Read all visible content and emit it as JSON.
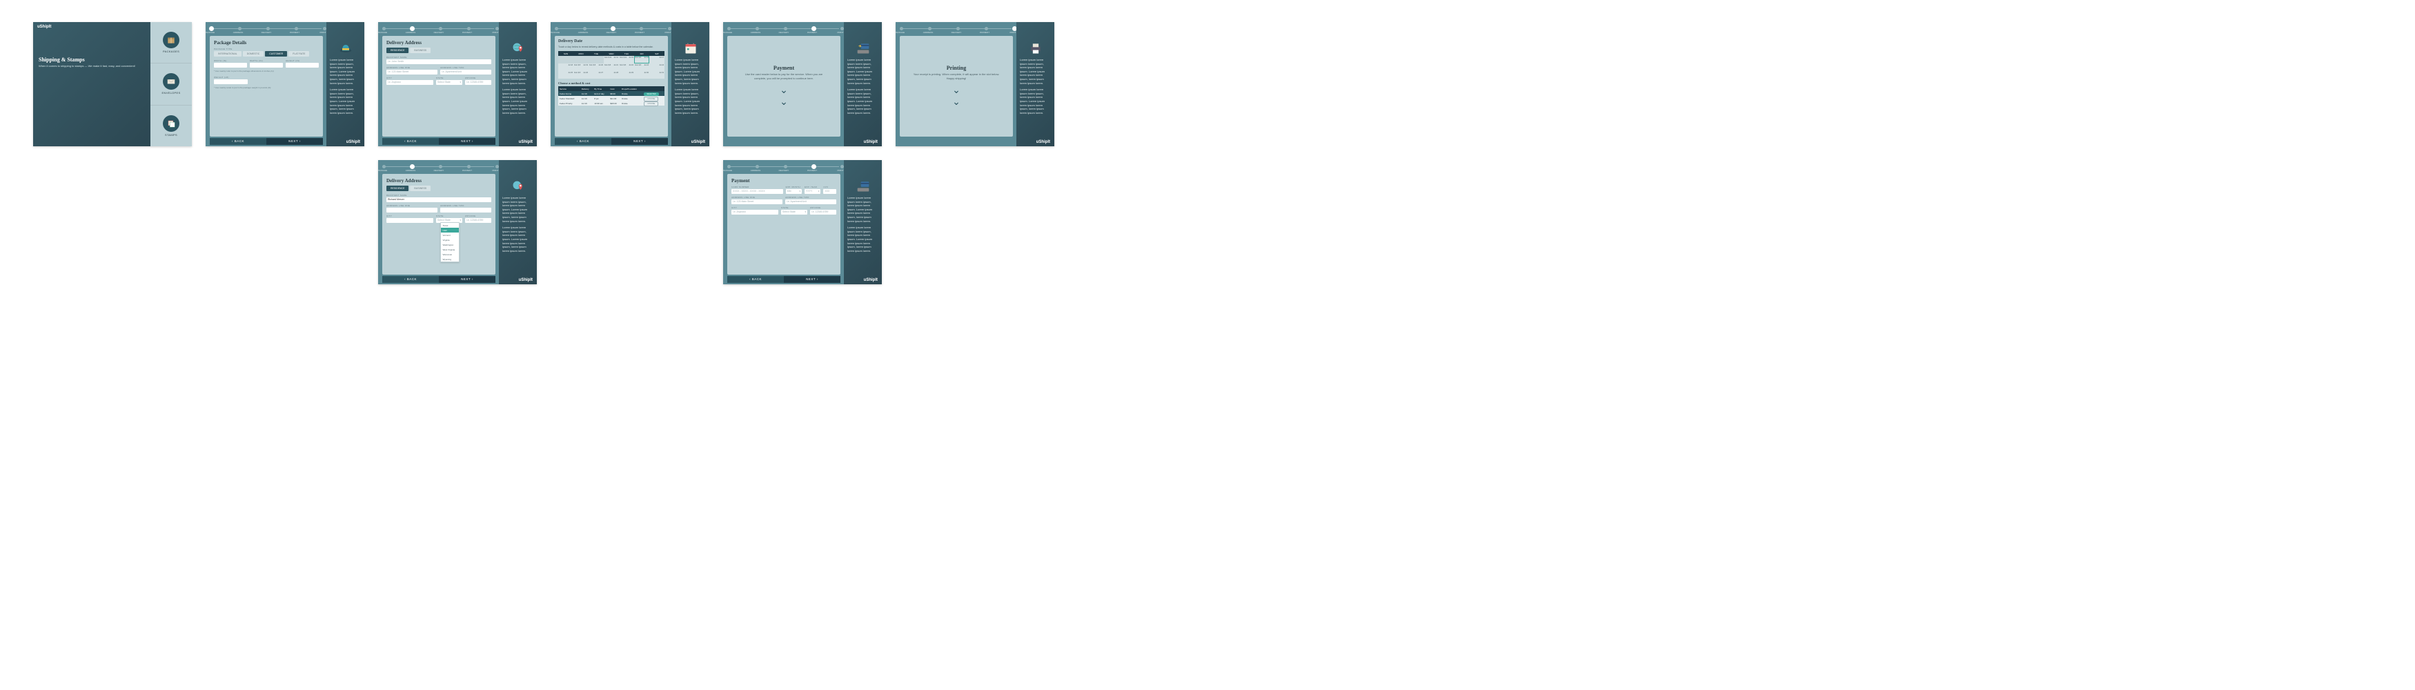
{
  "brand": "uShipIt",
  "lorem_block": "Lorem ipsum lorem ipsum lorem ipsum, lorem ipsum lorem ipsum. Lorem ipsum lorem ipsum lorem ipsum, lorem ipsum lorem ipsum lorem.",
  "stepper": {
    "steps": [
      "PACKAGE",
      "ADDRESS",
      "DELIVERY",
      "PAYMENT",
      "PRINT"
    ]
  },
  "nav": {
    "back": "‹ BACK",
    "next": "NEXT ›"
  },
  "landing": {
    "title": "Shipping & Stamps",
    "tagline": "When it comes to shipping to stamps — We make it fast, easy, and convenient!",
    "menu": [
      {
        "label": "PACKAGES",
        "icon": "box"
      },
      {
        "label": "ENVELOPES",
        "icon": "envelope"
      },
      {
        "label": "STAMPS",
        "icon": "stamps"
      }
    ]
  },
  "package": {
    "title": "Package Details",
    "section_type": "PACKAGE TYPE",
    "tabs": [
      "INTERNATIONAL",
      "DOMESTIC",
      "CUSTOMER",
      "FLAT RATE"
    ],
    "tab_active": 2,
    "dims_label": "WIDTH (IN)",
    "dims2": "DEPTH (IN)",
    "dims3": "HEIGHT (IN)",
    "dims_note": "* Use nearby ruler to put in the package dimensions in inches (in)",
    "weight_label": "WEIGHT (LB)",
    "weight_note": "* Use nearby scale to put in the package weight in pounds (lb)"
  },
  "address": {
    "title": "Delivery Address",
    "tabs": [
      "RESIDENCE",
      "BUSINESS"
    ],
    "tab_active": 0,
    "labels": {
      "name": "RECIPIENT NAME",
      "addr1": "ADDRESS LINE ONE",
      "addr2": "ADDRESS LINE TWO",
      "city": "CITY",
      "state": "STATE",
      "zip": "ZIPCODE"
    },
    "placeholders": {
      "name": "i.e. John Smith",
      "addr1": "i.e. 123 Main Street",
      "addr2": "i.e. Apartment/Unit",
      "city": "i.e. Anytown",
      "state": "Select State",
      "zip": "i.e. 12345-6789"
    },
    "filled_name": "Richard Mercer",
    "states": [
      "Texas",
      "Utah",
      "Vermont",
      "Virginia",
      "Washington",
      "West Virginia",
      "Wisconsin",
      "Wyoming"
    ],
    "state_hl": 1
  },
  "delivery": {
    "title": "Delivery Date",
    "sub": "Touch a day below to reveal delivery-date methods & costs in a table below the calendar.",
    "dow": [
      "SUN",
      "MON",
      "TUE",
      "WED",
      "THU",
      "FRI",
      "SAT"
    ],
    "grid": [
      [
        {
          "d": ""
        },
        {
          "d": ""
        },
        {
          "d": ""
        },
        {
          "d": "Jul 14",
          "p": "from $ 11"
        },
        {
          "d": "Jul 15",
          "p": "from $ 11"
        },
        {
          "d": "Jul 16",
          "p": "from $ 8",
          "sel": true
        },
        {
          "d": "Jul 17"
        }
      ],
      [
        {
          "d": "Jul 18"
        },
        {
          "d": "Jul 19",
          "p": "from $ 8"
        },
        {
          "d": "Jul 20",
          "p": "from $ 8"
        },
        {
          "d": "Jul 21",
          "p": "from $ 8"
        },
        {
          "d": "Jul 22",
          "p": "from $ 8"
        },
        {
          "d": "Jul 23",
          "p": "from $ 8"
        },
        {
          "d": "Jul 24"
        }
      ],
      [
        {
          "d": "Jul 25"
        },
        {
          "d": "Jul 26",
          "p": "from $ 8"
        },
        {
          "d": "Jul 27",
          "p": ""
        },
        {
          "d": "Jul 28",
          "p": ""
        },
        {
          "d": "Jul 29",
          "p": ""
        },
        {
          "d": "Jul 30",
          "p": ""
        },
        {
          "d": "Jul 31"
        }
      ]
    ],
    "method_title": "Choose a method & cost",
    "mheaders": [
      "Service",
      "Delivery",
      "By Time",
      "Cost",
      "Dropoff Location",
      ""
    ],
    "methods": [
      {
        "svc": "Fedex Home",
        "del": "Jul 16",
        "by": "End of day",
        "cost": "$8.00",
        "loc": "Onsite",
        "action": "SELECTED",
        "sel": true
      },
      {
        "svc": "Fedex Standard",
        "del": "Jul 16",
        "by": "8 pm",
        "cost": "$11.00",
        "loc": "Onsite",
        "action": "CHOOSE"
      },
      {
        "svc": "Fedex Priority",
        "del": "Jul 16",
        "by": "10:30 am",
        "cost": "$18.00",
        "loc": "Onsite",
        "action": "CHOOSE"
      }
    ]
  },
  "payment": {
    "title": "Payment",
    "blurb": "Use the card reader below to pay for the service. When you are complete, you will be prompted to continue here.",
    "form": {
      "labels": {
        "card": "CARD NUMBER",
        "mm": "EXP. MONTH",
        "yy": "EXP. YEAR",
        "cvv": "CVV",
        "addr1": "ADDRESS LINE ONE",
        "addr2": "ADDRESS LINE TWO",
        "city": "CITY",
        "state": "STATE",
        "zip": "ZIPCODE"
      },
      "placeholders": {
        "card": "XXXX - XXXX - XXXX - XXXX",
        "mm": "MM",
        "yy": "YYYY",
        "cvv": "XXX",
        "addr1": "i.e. 123 Main Street",
        "addr2": "i.e. Apartment/Unit",
        "city": "i.e. Anytown",
        "state": "Select State",
        "zip": "i.e. 12345-6789"
      }
    }
  },
  "printing": {
    "title": "Printing",
    "blurb": "Your receipt is printing. When complete, it will appear in the slot below. Happy shipping!"
  }
}
